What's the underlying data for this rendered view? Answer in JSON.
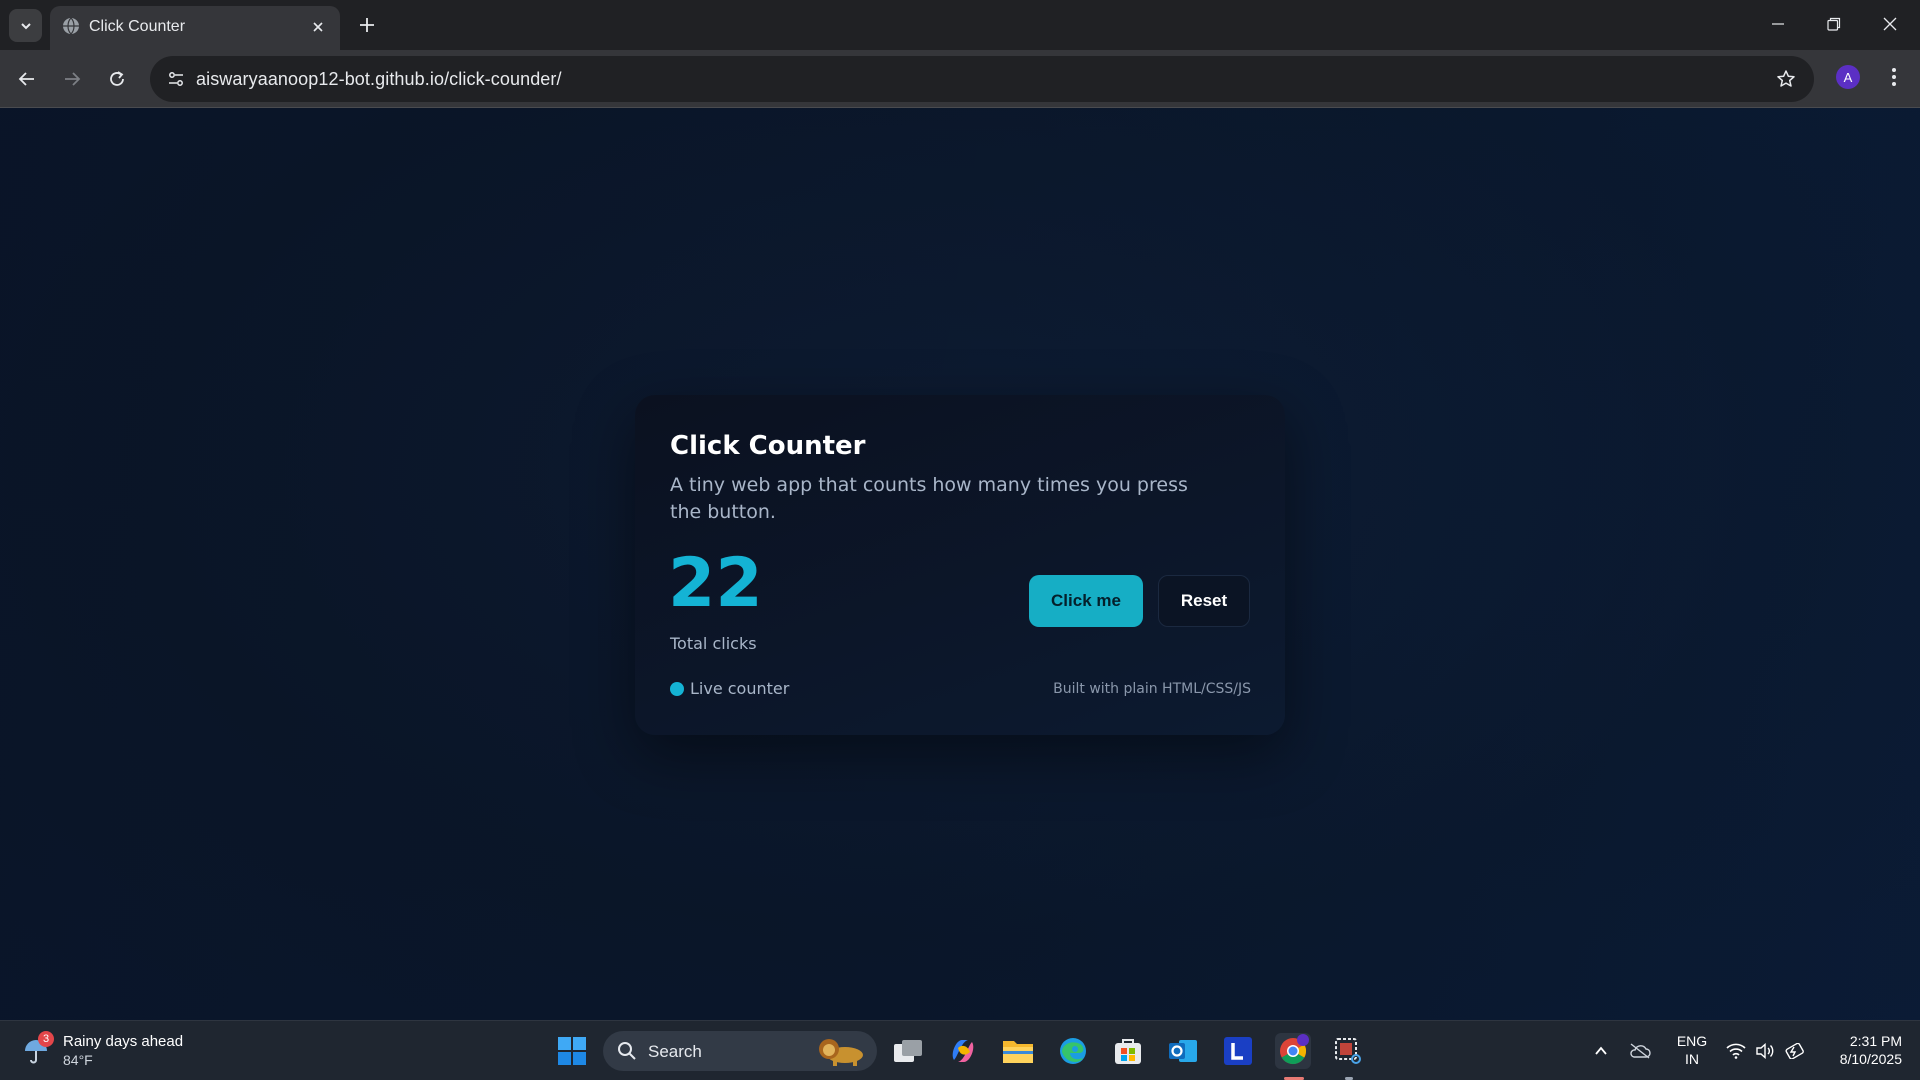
{
  "browser": {
    "tab": {
      "title": "Click Counter",
      "favicon": "globe-icon"
    },
    "url": "aiswaryaanoop12-bot.github.io/click-counder/",
    "profile_initial": "A"
  },
  "page": {
    "title": "Click Counter",
    "description": "A tiny web app that counts how many times you press the button.",
    "count": "22",
    "count_label": "Total clicks",
    "click_button": "Click me",
    "reset_button": "Reset",
    "live_label": "Live counter",
    "footer_note": "Built with plain HTML/CSS/JS",
    "colors": {
      "accent": "#14b3d4",
      "background": "#0a1629",
      "card": "#0b1120"
    }
  },
  "taskbar": {
    "weather": {
      "title": "Rainy days ahead",
      "temp": "84°F",
      "badge": "3"
    },
    "search_placeholder": "Search",
    "lang_line1": "ENG",
    "lang_line2": "IN",
    "time": "2:31 PM",
    "date": "8/10/2025",
    "apps": [
      "start-icon",
      "task-view-icon",
      "copilot-icon",
      "file-explorer-icon",
      "edge-icon",
      "store-icon",
      "outlook-icon",
      "l-app-icon",
      "chrome-icon",
      "snipping-tool-icon"
    ]
  }
}
